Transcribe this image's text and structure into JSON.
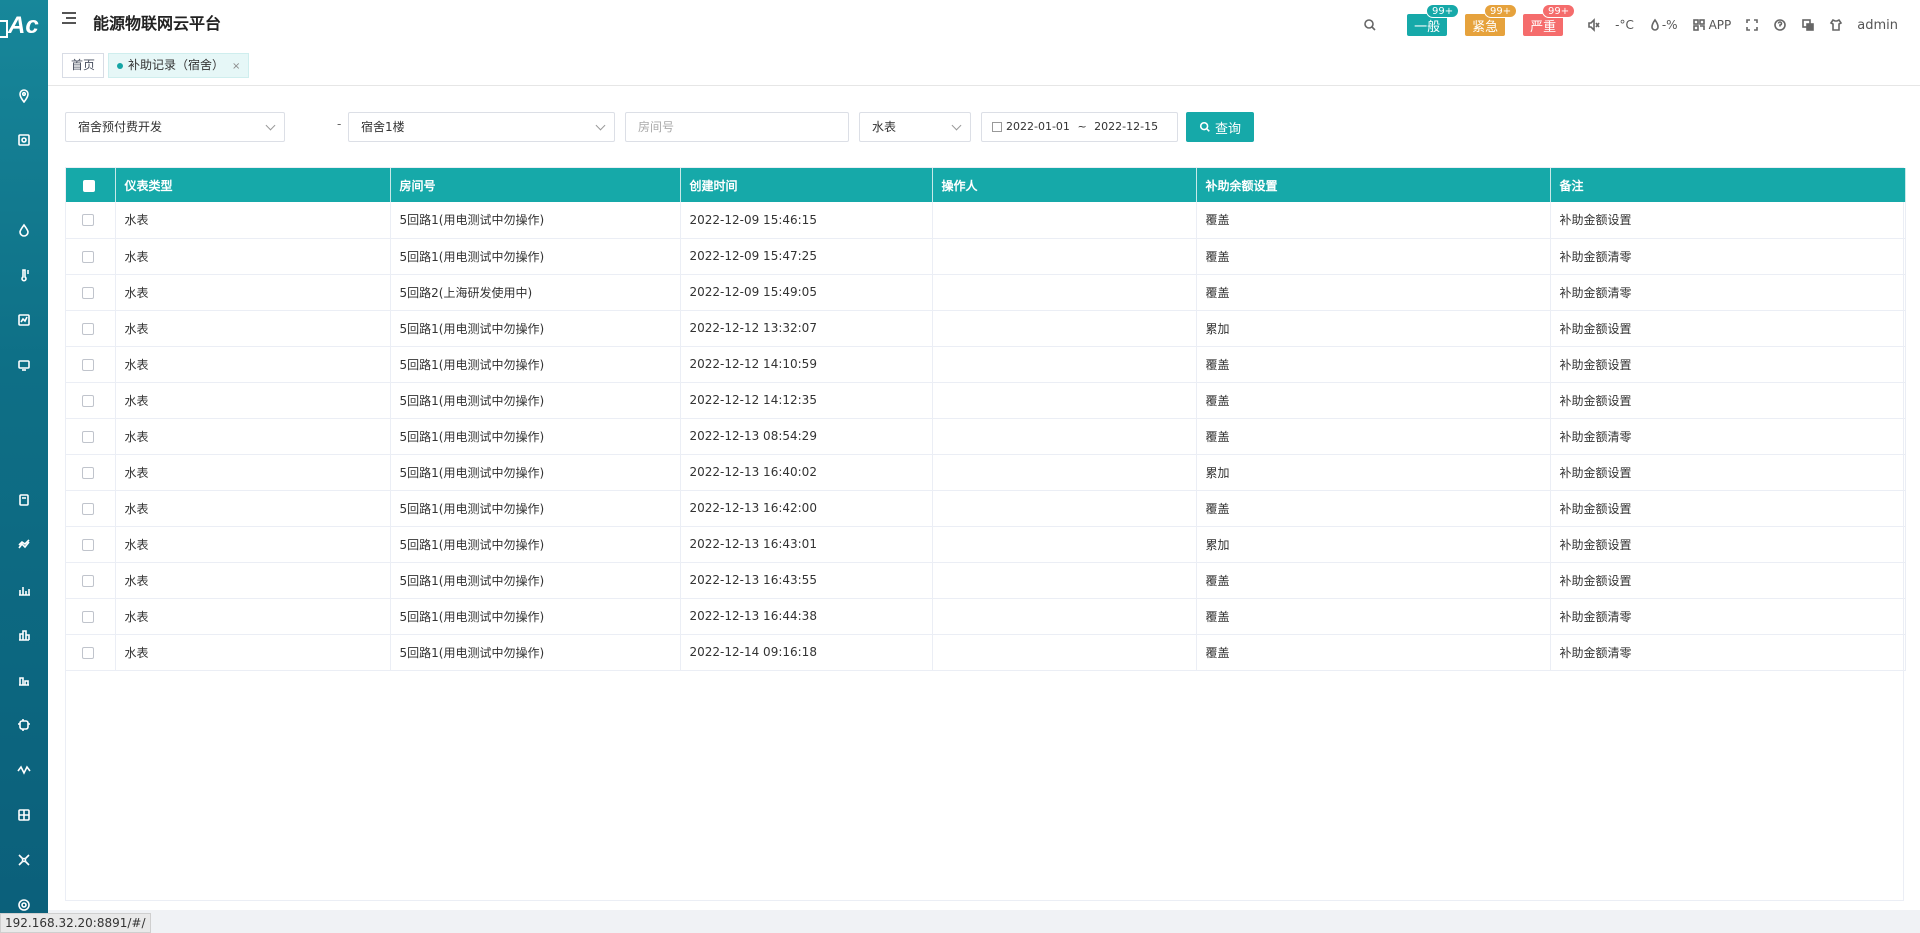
{
  "sidebar": {
    "logo_text": "Ac"
  },
  "header": {
    "title": "能源物联网云平台",
    "alarms": [
      {
        "label": "一般",
        "count": "99+",
        "color": "#16a9a9"
      },
      {
        "label": "紧急",
        "count": "99+",
        "color": "#e6a23c"
      },
      {
        "label": "严重",
        "count": "99+",
        "color": "#f56c6c"
      }
    ],
    "temperature": "-°C",
    "humidity": "-%",
    "app_label": "APP",
    "user": "admin"
  },
  "tabs": {
    "home": "首页",
    "active": "补助记录（宿舍）",
    "close": "×"
  },
  "filters": {
    "project": "宿舍预付费开发",
    "separator": "-",
    "building": "宿舍1楼",
    "room_placeholder": "房间号",
    "meter_type": "水表",
    "date_start": "2022-01-01",
    "date_sep": "~",
    "date_end": "2022-12-15",
    "query_label": "查询"
  },
  "table": {
    "headers": [
      "仪表类型",
      "房间号",
      "创建时间",
      "操作人",
      "补助余额设置",
      "备注"
    ],
    "rows": [
      [
        "水表",
        "5回路1(用电测试中勿操作)",
        "2022-12-09 15:46:15",
        "",
        "覆盖",
        "补助金额设置"
      ],
      [
        "水表",
        "5回路1(用电测试中勿操作)",
        "2022-12-09 15:47:25",
        "",
        "覆盖",
        "补助金额清零"
      ],
      [
        "水表",
        "5回路2(上海研发使用中)",
        "2022-12-09 15:49:05",
        "",
        "覆盖",
        "补助金额清零"
      ],
      [
        "水表",
        "5回路1(用电测试中勿操作)",
        "2022-12-12 13:32:07",
        "",
        "累加",
        "补助金额设置"
      ],
      [
        "水表",
        "5回路1(用电测试中勿操作)",
        "2022-12-12 14:10:59",
        "",
        "覆盖",
        "补助金额设置"
      ],
      [
        "水表",
        "5回路1(用电测试中勿操作)",
        "2022-12-12 14:12:35",
        "",
        "覆盖",
        "补助金额设置"
      ],
      [
        "水表",
        "5回路1(用电测试中勿操作)",
        "2022-12-13 08:54:29",
        "",
        "覆盖",
        "补助金额清零"
      ],
      [
        "水表",
        "5回路1(用电测试中勿操作)",
        "2022-12-13 16:40:02",
        "",
        "累加",
        "补助金额设置"
      ],
      [
        "水表",
        "5回路1(用电测试中勿操作)",
        "2022-12-13 16:42:00",
        "",
        "覆盖",
        "补助金额设置"
      ],
      [
        "水表",
        "5回路1(用电测试中勿操作)",
        "2022-12-13 16:43:01",
        "",
        "累加",
        "补助金额设置"
      ],
      [
        "水表",
        "5回路1(用电测试中勿操作)",
        "2022-12-13 16:43:55",
        "",
        "覆盖",
        "补助金额设置"
      ],
      [
        "水表",
        "5回路1(用电测试中勿操作)",
        "2022-12-13 16:44:38",
        "",
        "覆盖",
        "补助金额清零"
      ],
      [
        "水表",
        "5回路1(用电测试中勿操作)",
        "2022-12-14 09:16:18",
        "",
        "覆盖",
        "补助金额清零"
      ]
    ]
  },
  "status_bar": {
    "url": "192.168.32.20:8891/#/"
  }
}
